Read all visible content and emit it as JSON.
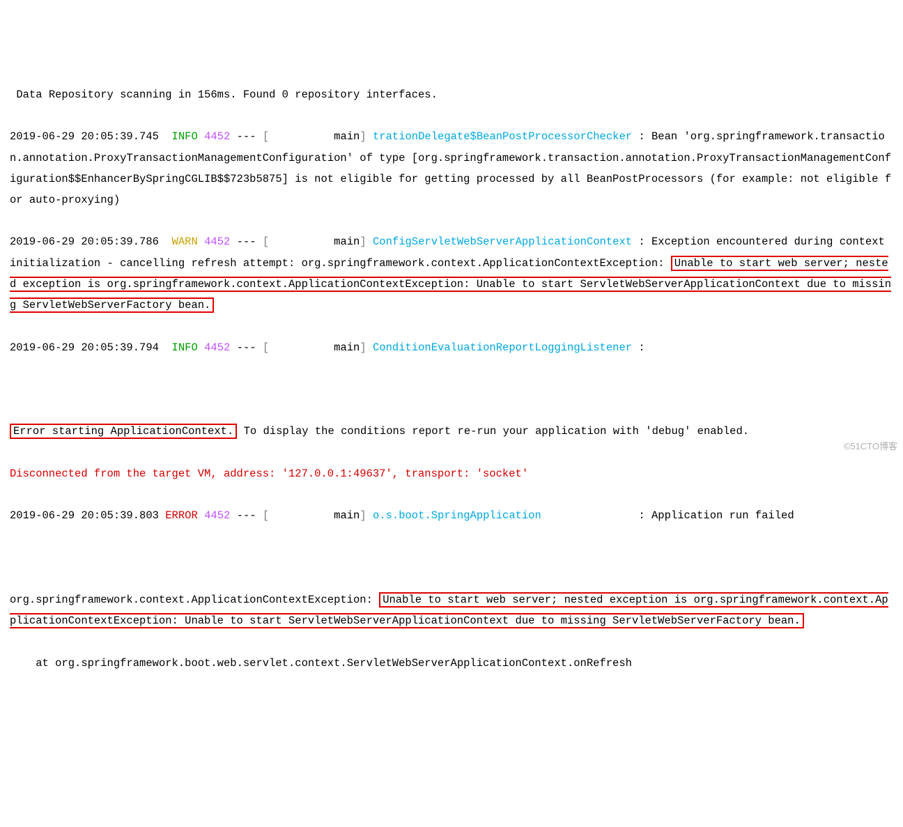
{
  "lines": {
    "l0": " Data Repository scanning in 156ms. Found 0 repository interfaces.",
    "ts1": "2019-06-29 20:05:39.745",
    "lvl1": "INFO",
    "pid1": "4452",
    "dash": "---",
    "lb": "[",
    "thread_main": "          main",
    "rb": "]",
    "logger1": "trationDelegate$BeanPostProcessorChecker",
    "colon": " : ",
    "msg1": "Bean 'org.springframework.transaction.annotation.ProxyTransactionManagementConfiguration' of type [org.springframework.transaction.annotation.ProxyTransactionManagementConfiguration$$EnhancerBySpringCGLIB$$723b5875] is not eligible for getting processed by all BeanPostProcessors (for example: not eligible for auto-proxying)",
    "ts2": "2019-06-29 20:05:39.786",
    "lvl2": "WARN",
    "logger2": "ConfigServletWebServerApplicationContext",
    "msg2a": "Exception encountered during context initialization - cancelling refresh attempt: org.springframework.context.ApplicationContextException: ",
    "msg2box": "Unable to start web server; nested exception is org.springframework.context.ApplicationContextException: Unable to start ServletWebServerApplicationContext due to missing ServletWebServerFactory bean.",
    "ts3": "2019-06-29 20:05:39.794",
    "logger3": "ConditionEvaluationReportLoggingListener",
    "msg3": "",
    "blank": "",
    "err_start_box": "Error starting ApplicationContext.",
    "err_start_tail": " To display the conditions report re-run your application with 'debug' enabled.",
    "disconnected": "Disconnected from the target VM, address: '127.0.0.1:49637', transport: 'socket'",
    "ts4": "2019-06-29 20:05:39.803",
    "lvl4": "ERROR",
    "logger4": "o.s.boot.SpringApplication",
    "logger4_pad": "              ",
    "msg4": "Application run failed",
    "ex_prefix": "org.springframework.context.ApplicationContextException: ",
    "ex_box": "Unable to start web server; nested exception is org.springframework.context.ApplicationContextException: Unable to start ServletWebServerApplicationContext due to missing ServletWebServerFactory bean.",
    "stack_at": "    at org.springframework.boot.web.servlet.context.ServletWebServerApplicationContext.onRefresh"
  },
  "watermark": "©51CTO博客"
}
